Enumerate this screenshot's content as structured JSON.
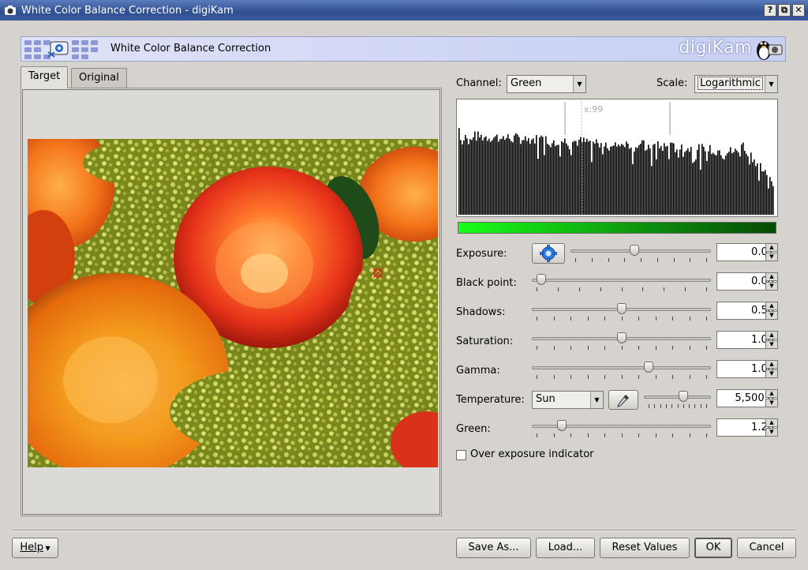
{
  "window": {
    "title": "White Color Balance Correction - digiKam",
    "buttons": {
      "help": "?",
      "restore": "⧉",
      "close": "✕"
    }
  },
  "banner": {
    "title": "White Color Balance Correction",
    "brand": "digiKam"
  },
  "tabs": [
    {
      "label": "Target",
      "active": true
    },
    {
      "label": "Original",
      "active": false
    }
  ],
  "histogram": {
    "channel_label": "Channel:",
    "channel_value": "Green",
    "scale_label": "Scale:",
    "scale_value": "Logarithmic",
    "cursor_label": "x:99",
    "gradient_color_start": "#18ff18"
  },
  "controls": {
    "exposure": {
      "label": "Exposure:",
      "value": "0.01",
      "position": 0.45
    },
    "black_point": {
      "label": "Black point:",
      "value": "0.00",
      "position": 0.03
    },
    "shadows": {
      "label": "Shadows:",
      "value": "0.50",
      "position": 0.5
    },
    "saturation": {
      "label": "Saturation:",
      "value": "1.00",
      "position": 0.5
    },
    "gamma": {
      "label": "Gamma:",
      "value": "1.00",
      "position": 0.66
    },
    "temperature": {
      "label": "Temperature:",
      "preset": "Sun",
      "value": "5,500.0",
      "position": 0.6
    },
    "green": {
      "label": "Green:",
      "value": "1.20",
      "position": 0.15
    },
    "over_exposure": {
      "label": "Over exposure indicator",
      "checked": false
    }
  },
  "footer": {
    "help": "Help",
    "save_as": "Save As...",
    "load": "Load...",
    "reset": "Reset Values",
    "ok": "OK",
    "cancel": "Cancel"
  },
  "icons": {
    "exposure_auto": "gear-icon",
    "temperature_picker": "eyedropper-icon",
    "window_app": "app-icon"
  }
}
